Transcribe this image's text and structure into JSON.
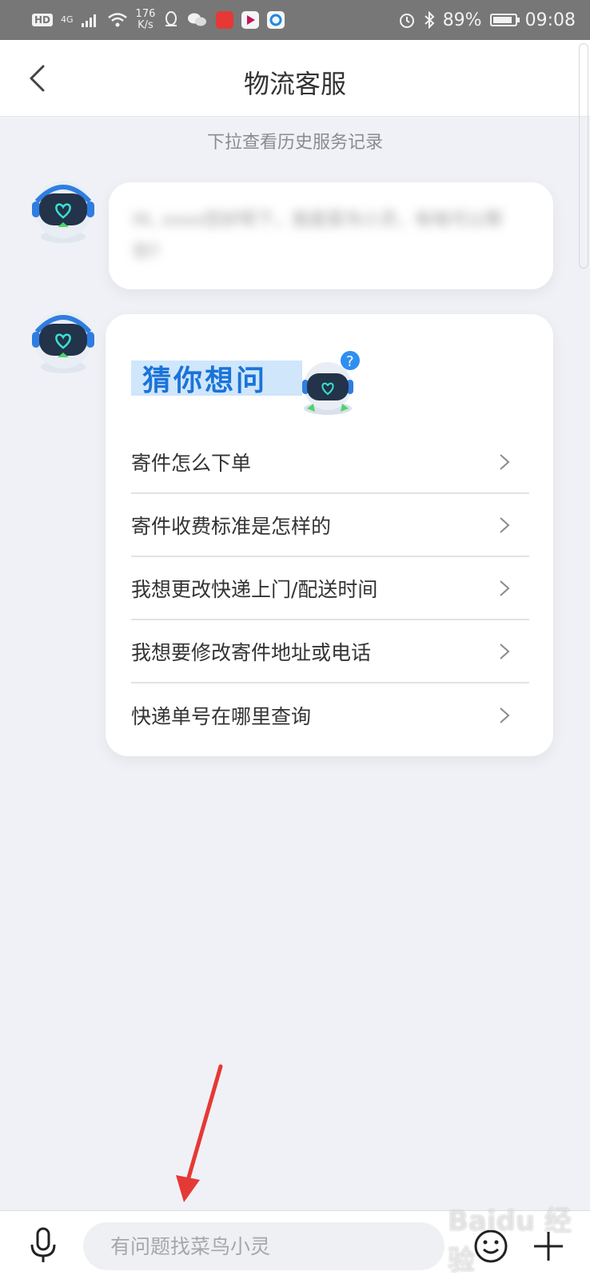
{
  "status_bar": {
    "hd": "HD",
    "network": "4G",
    "speed_value": "176",
    "speed_unit": "K/s",
    "battery": "89%",
    "battery_level": 0.89,
    "time": "09:08",
    "icons": [
      "wifi-icon",
      "qq-icon",
      "wechat-icon",
      "alarm-icon",
      "bluetooth-icon"
    ]
  },
  "header": {
    "title": "物流客服",
    "back_icon": "chevron-left-icon"
  },
  "history_hint": "下拉查看历史服务记录",
  "messages": {
    "greeting_blurred": "Hi, xxxx您好呀下，我是菜鸟小灵，有啥可以帮你?"
  },
  "suggestions": {
    "banner_title": "猜你想问",
    "items": [
      {
        "label": "寄件怎么下单"
      },
      {
        "label": "寄件收费标准是怎样的"
      },
      {
        "label": "我想更改快递上门/配送时间"
      },
      {
        "label": "我想要修改寄件地址或电话"
      },
      {
        "label": "快递单号在哪里查询"
      }
    ]
  },
  "input_bar": {
    "placeholder": "有问题找菜鸟小灵",
    "value": ""
  },
  "watermark": "Baidu 经验",
  "colors": {
    "accent": "#1a73d9",
    "page_bg": "#f0f1f6",
    "status_bar": "#777777",
    "annotation_arrow": "#e53935",
    "robot_screen": "#22334a",
    "robot_heart": "#3ce0d0"
  }
}
